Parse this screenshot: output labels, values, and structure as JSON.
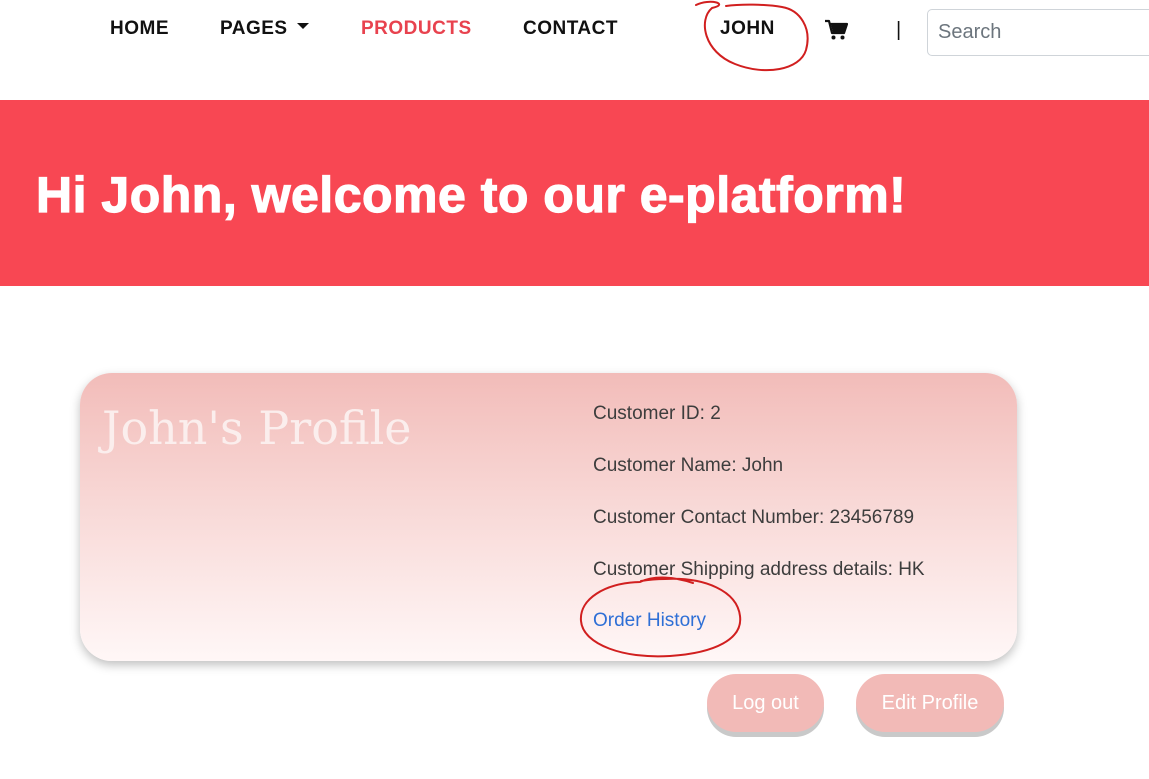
{
  "nav": {
    "home": "HOME",
    "pages": "PAGES",
    "products": "PRODUCTS",
    "contact": "CONTACT",
    "user": "JOHN",
    "cart_icon": "shopping-cart-icon",
    "divider": "|",
    "search_placeholder": "Search"
  },
  "hero": {
    "title": "Hi John, welcome to our e-platform!"
  },
  "profile": {
    "title": "John's Profile",
    "customer_id": "Customer ID: 2",
    "customer_name": "Customer Name: John",
    "contact_number": "Customer Contact Number: 23456789",
    "shipping_address": "Customer Shipping address details: HK",
    "order_history": "Order History"
  },
  "buttons": {
    "logout": "Log out",
    "edit_profile": "Edit Profile"
  },
  "colors": {
    "accent": "#f84753",
    "active_nav": "#e8424e",
    "link": "#2e6fd6",
    "button": "#f2bab7",
    "annotation": "#d11f1f"
  }
}
